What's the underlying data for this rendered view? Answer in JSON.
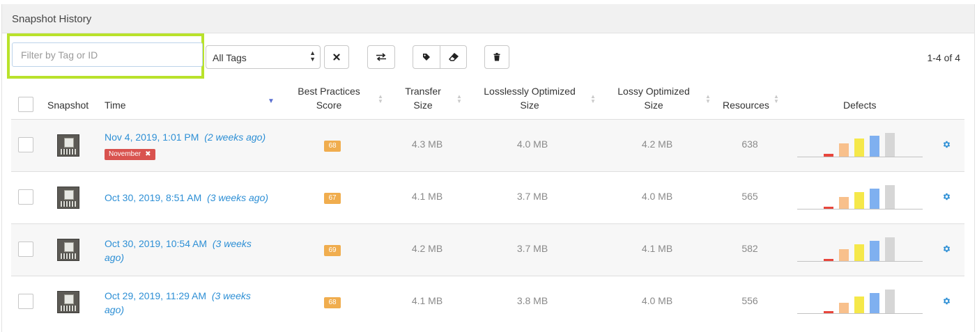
{
  "panel": {
    "title": "Snapshot History"
  },
  "toolbar": {
    "filter_placeholder": "Filter by Tag or ID",
    "filter_value": "",
    "tag_select_value": "All Tags",
    "pagination": "1-4 of 4"
  },
  "columns": {
    "snapshot": "Snapshot",
    "time": "Time",
    "best_practices_1": "Best Practices",
    "best_practices_2": "Score",
    "transfer_1": "Transfer",
    "transfer_2": "Size",
    "lossless_1": "Losslessly Optimized",
    "lossless_2": "Size",
    "lossy_1": "Lossy Optimized",
    "lossy_2": "Size",
    "resources": "Resources",
    "defects": "Defects"
  },
  "rows": [
    {
      "time_main": "Nov 4, 2019, 1:01 PM",
      "time_ago": "(2 weeks ago)",
      "tag": "November",
      "score": "68",
      "transfer": "4.3 MB",
      "lossless": "4.0 MB",
      "lossy": "4.2 MB",
      "resources": "638",
      "defects": [
        0.12,
        0.55,
        0.75,
        0.88,
        1.0
      ]
    },
    {
      "time_main": "Oct 30, 2019, 8:51 AM",
      "time_ago": "(3 weeks ago)",
      "tag": "",
      "score": "67",
      "transfer": "4.1 MB",
      "lossless": "3.7 MB",
      "lossy": "4.0 MB",
      "resources": "565",
      "defects": [
        0.1,
        0.5,
        0.72,
        0.86,
        1.0
      ]
    },
    {
      "time_main": "Oct 30, 2019, 10:54 AM",
      "time_ago": "(3 weeks ago)",
      "tag": "",
      "score": "69",
      "transfer": "4.2 MB",
      "lossless": "3.7 MB",
      "lossy": "4.1 MB",
      "resources": "582",
      "defects": [
        0.1,
        0.5,
        0.72,
        0.86,
        1.0
      ]
    },
    {
      "time_main": "Oct 29, 2019, 11:29 AM",
      "time_ago": "(3 weeks ago)",
      "tag": "",
      "score": "68",
      "transfer": "4.1 MB",
      "lossless": "3.8 MB",
      "lossy": "4.0 MB",
      "resources": "556",
      "defects": [
        0.1,
        0.45,
        0.7,
        0.86,
        1.0
      ]
    }
  ],
  "colors": {
    "highlight": "#b9e22b",
    "link": "#2d8fd5",
    "score_badge": "#f0ad4e",
    "tag_badge": "#d9534f",
    "defect_colors": [
      "#e8463c",
      "#f8c08c",
      "#f5e84a",
      "#7fb0f0",
      "#d6d6d6"
    ],
    "gear": "#2d8fd5"
  },
  "icons": {
    "clear": "close-icon",
    "compare": "swap-arrows-icon",
    "tag": "tag-icon",
    "untag": "eraser-icon",
    "delete": "trash-icon",
    "row_action": "gear-icon"
  }
}
